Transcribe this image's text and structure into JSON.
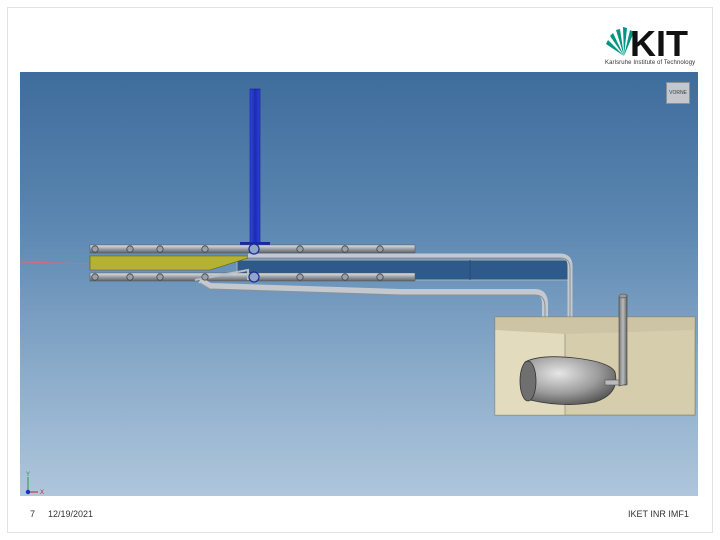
{
  "logo": {
    "letters": "KIT",
    "subtitle": "Karlsruhe Institute of Technology",
    "brand_color": "#009682"
  },
  "viewport": {
    "viewcube_label": "VORNE",
    "axes": {
      "x": "X",
      "y": "Y"
    },
    "colors": {
      "bg_top": "#3e6c9c",
      "bg_bottom": "#afc6dc",
      "vertical_pipe": "#2135c8",
      "insert_strip": "#b5b233",
      "tank": "#d9d1b1"
    }
  },
  "footer": {
    "slide_number": "7",
    "date": "12/19/2021",
    "org": "IKET INR IMF1"
  }
}
